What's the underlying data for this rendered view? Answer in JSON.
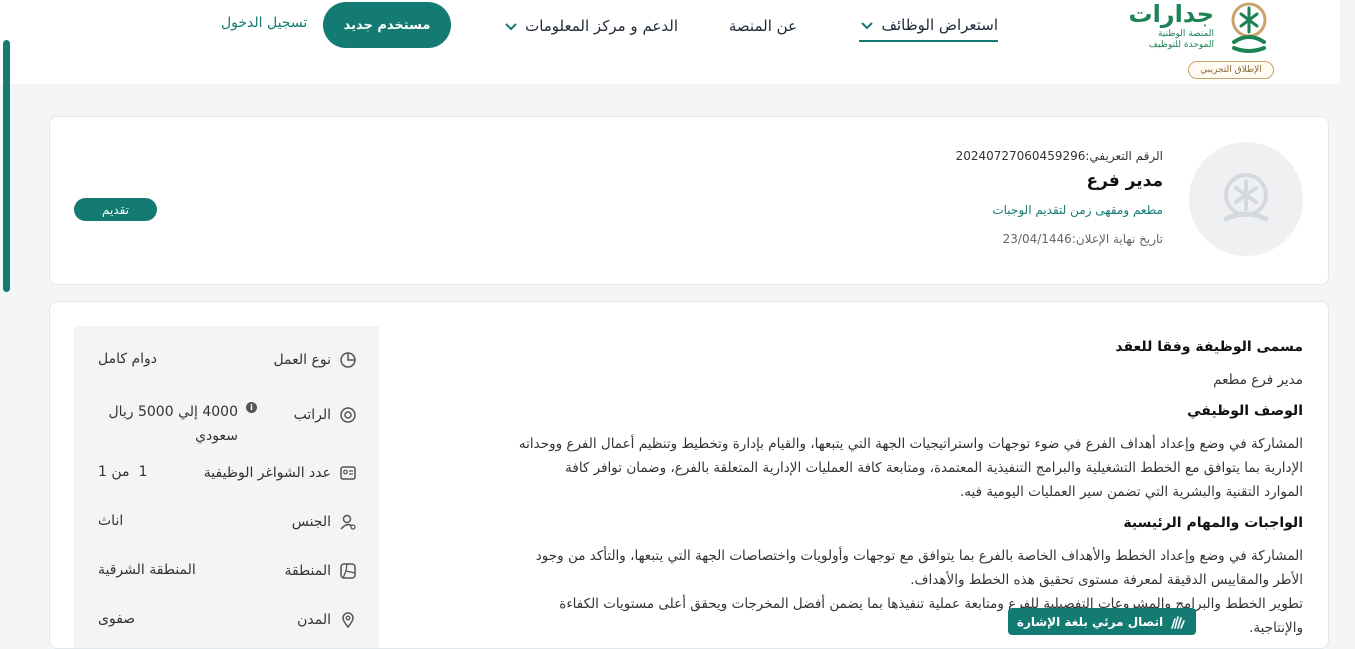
{
  "header": {
    "logo": {
      "name": "جدارات",
      "sub1": "المنصة الوطنية",
      "sub2": "الموحدة للتوظيف",
      "badge": "الإطلاق التجريبي"
    },
    "nav": {
      "jobs": "استعراض الوظائف",
      "about": "عن المنصة",
      "support": "الدعم و مركز المعلومات"
    },
    "signup": "مستخدم جديد",
    "login": "تسجيل الدخول"
  },
  "job": {
    "ref": "الرقم التعريفي:20240727060459296",
    "title": "مدير فرع",
    "company": "مطعم ومقهى زمن لتقديم الوجبات",
    "deadline": "تاريخ نهاية الإعلان:23/04/1446",
    "apply": "تقديم"
  },
  "details": {
    "sections": {
      "contract_title_heading": "مسمى الوظيفة وفقا للعقد",
      "contract_title": "مدير فرع مطعم",
      "description_heading": "الوصف الوظيفي",
      "description_lines": [
        "المشاركة في وضع وإعداد أهداف الفرع في ضوء توجهات واستراتيجيات الجهة التي يتبعها، والقيام بإدارة وتخطيط وتنظيم أعمال الفرع ووحداته",
        "الإدارية بما يتوافق مع الخطط التشغيلية والبرامج التنفيذية المعتمدة، ومتابعة كافة العمليات الإدارية المتعلقة بالفرع، وضمان توافر كافة",
        "الموارد التقنية والبشرية التي تضمن سير العمليات اليومية فيه."
      ],
      "duties_heading": "الواجبات والمهام الرئيسية",
      "duties_lines": [
        "المشاركة في وضع وإعداد الخطط والأهداف الخاصة بالفرع بما يتوافق مع توجهات وأولويات واختصاصات الجهة التي يتبعها، والتأكد من وجود",
        "الأطر والمقاييس الدقيقة لمعرفة مستوى تحقيق هذه الخطط والأهداف.",
        "تطوير الخطط والبرامج والمشروعات التفصيلية للفرع ومتابعة عملية تنفيذها بما يضمن أفضل المخرجات ويحقق أعلى مستويات الكفاءة",
        "والإنتاجية."
      ]
    },
    "side": [
      {
        "label": "نوع العمل",
        "value": "دوام كامل",
        "icon": "pie-chart-icon"
      },
      {
        "label": "الراتب",
        "value": "4000 إلي 5000 ريال سعودي",
        "icon": "money-icon"
      },
      {
        "label": "عدد الشواغر الوظيفية",
        "value": "1  من 1",
        "icon": "id-card-icon"
      },
      {
        "label": "الجنس",
        "value": "اناث",
        "icon": "user-gender-icon"
      },
      {
        "label": "المنطقة",
        "value": "المنطقة الشرقية",
        "icon": "map-region-icon"
      },
      {
        "label": "المدن",
        "value": "صفوى",
        "icon": "location-pin-icon"
      }
    ],
    "info_mark": "i"
  },
  "sign_language": "اتصال مرئي بلغة الإشارة",
  "colors": {
    "primary": "#147b73",
    "brand_green": "#1b8354"
  }
}
